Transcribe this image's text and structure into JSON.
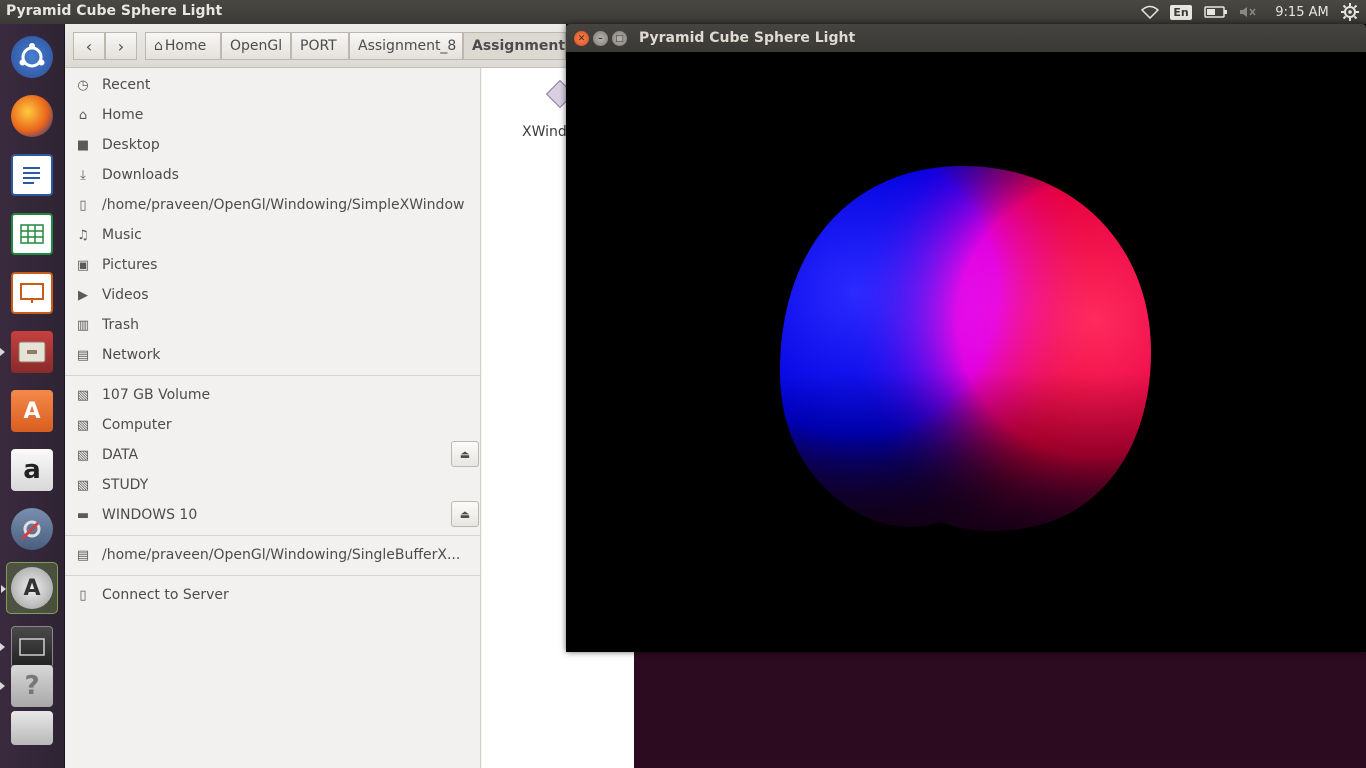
{
  "top_panel": {
    "app_title": "Pyramid Cube Sphere Light",
    "keyboard_layout": "En",
    "clock": "9:15 AM"
  },
  "launcher": {
    "items": [
      {
        "name": "ubuntu-dash"
      },
      {
        "name": "firefox"
      },
      {
        "name": "libreoffice-writer"
      },
      {
        "name": "libreoffice-calc"
      },
      {
        "name": "libreoffice-impress"
      },
      {
        "name": "files"
      },
      {
        "name": "ubuntu-software-center"
      },
      {
        "name": "amazon"
      },
      {
        "name": "system-settings"
      },
      {
        "name": "software-updater"
      },
      {
        "name": "workspaces"
      },
      {
        "name": "help"
      },
      {
        "name": "trash"
      }
    ]
  },
  "file_manager": {
    "breadcrumbs": [
      "Home",
      "OpenGl",
      "PORT",
      "Assignment_8",
      "Assignment_"
    ],
    "sidebar": {
      "places": [
        "Recent",
        "Home",
        "Desktop",
        "Downloads",
        "/home/praveen/OpenGl/Windowing/SimpleXWindow",
        "Music",
        "Pictures",
        "Videos",
        "Trash",
        "Network"
      ],
      "devices": [
        "107 GB Volume",
        "Computer",
        "DATA",
        "STUDY",
        "WINDOWS 10"
      ],
      "bookmarks": [
        "/home/praveen/OpenGl/Windowing/SingleBufferX..."
      ],
      "network": [
        "Connect to Server"
      ]
    },
    "content": {
      "file_label": "XWind"
    }
  },
  "gl_window": {
    "title": "Pyramid Cube Sphere Light",
    "colors": {
      "left_light": "#0000ff",
      "right_light": "#ff0000",
      "background": "#000000"
    }
  }
}
